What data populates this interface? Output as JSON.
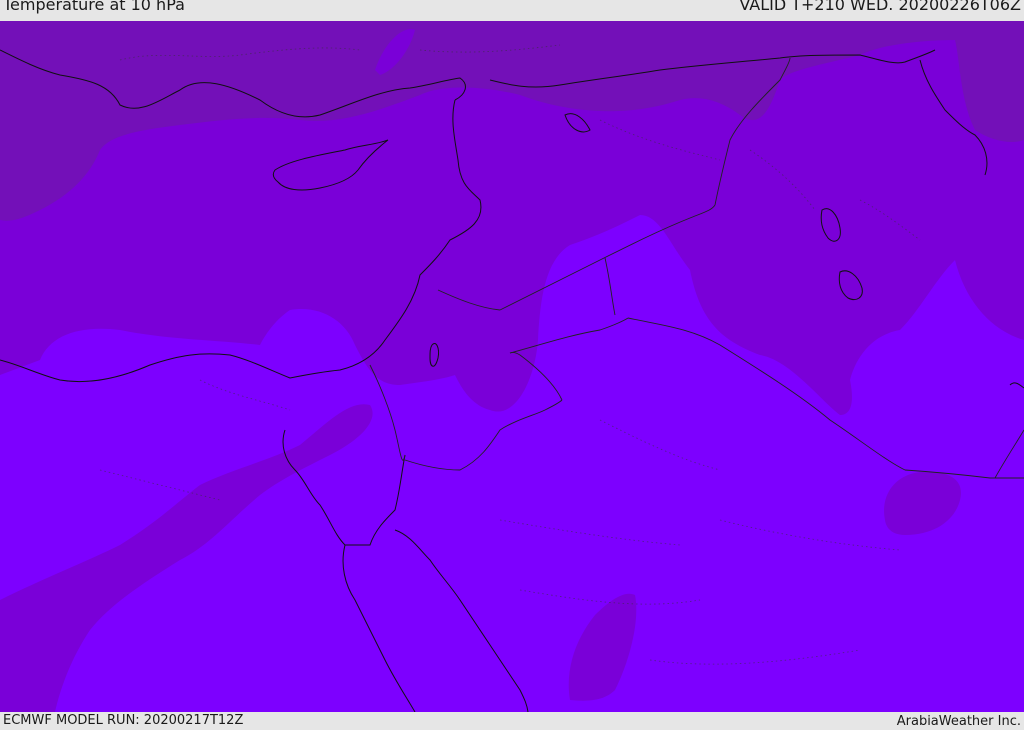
{
  "header": {
    "title": "Temperature at 10 hPa",
    "valid_time": "VALID T+210 WED. 20200226T06Z"
  },
  "footer": {
    "model_run": "ECMWF MODEL RUN: 20200217T12Z",
    "credit": "ArabiaWeather Inc."
  },
  "map": {
    "colors": {
      "dark_band": "#7310b8",
      "mid_band": "#7a00d8",
      "light_band": "#7d00ff",
      "coastline": "#111111",
      "borders": "#222222"
    }
  }
}
